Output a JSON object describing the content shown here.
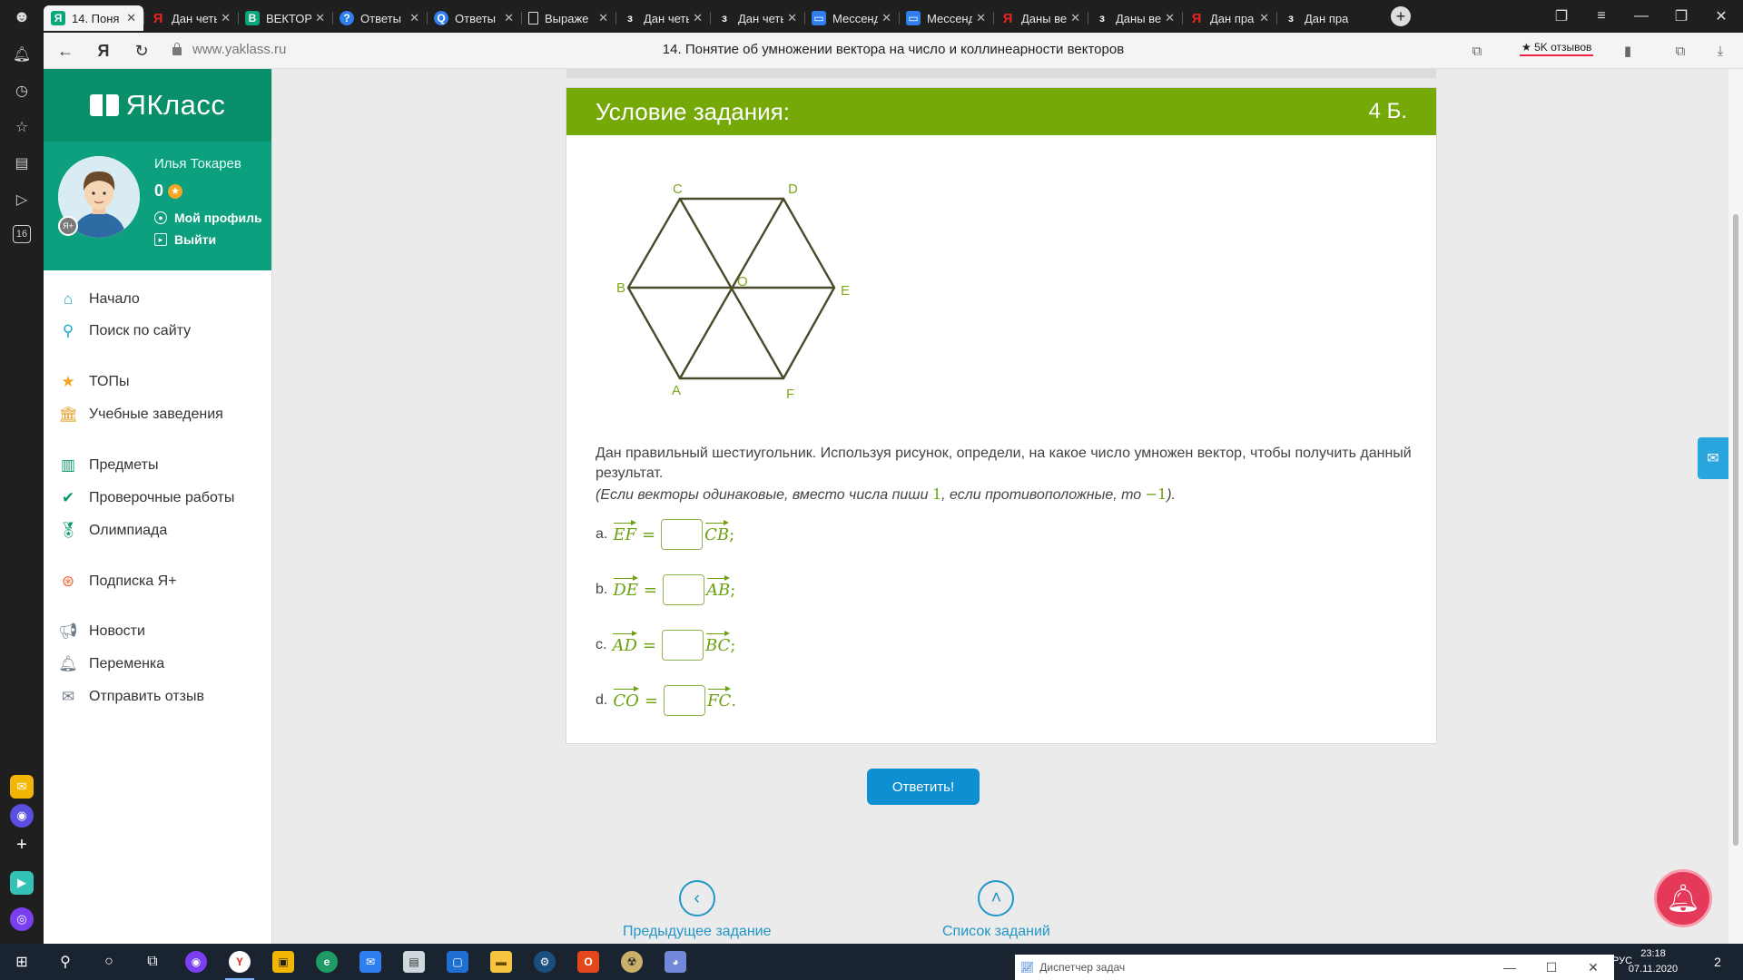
{
  "browser": {
    "tabs": [
      {
        "label": "14. Поня",
        "favicon": "yaklass",
        "active": true
      },
      {
        "label": "Дан четы",
        "favicon": "yandex"
      },
      {
        "label": "ВЕКТОР",
        "favicon": "document-green"
      },
      {
        "label": "Ответы",
        "favicon": "question"
      },
      {
        "label": "Ответы",
        "favicon": "search"
      },
      {
        "label": "Выраже",
        "favicon": "document"
      },
      {
        "label": "Дан четы",
        "favicon": "z"
      },
      {
        "label": "Дан четы",
        "favicon": "z"
      },
      {
        "label": "Мессенд",
        "favicon": "messenger"
      },
      {
        "label": "Мессенд",
        "favicon": "messenger"
      },
      {
        "label": "Даны ве",
        "favicon": "yandex"
      },
      {
        "label": "Даны ве",
        "favicon": "z"
      },
      {
        "label": "Дан пра",
        "favicon": "yandex"
      },
      {
        "label": "Дан пра",
        "favicon": "z"
      }
    ],
    "url": "www.yaklass.ru",
    "page_title": "14. Понятие об умножении вектора на число и коллинеарности векторов",
    "reviews": "★ 5K отзывов"
  },
  "sidebar": {
    "logo": "ЯКласс",
    "user": {
      "name": "Илья Токарев",
      "points": "0",
      "profile_link": "Мой профиль",
      "logout_link": "Выйти",
      "badge": "Я+"
    },
    "nav": [
      {
        "label": "Начало",
        "icon": "home-icon"
      },
      {
        "label": "Поиск по сайту",
        "icon": "search-icon"
      },
      {
        "label": "ТОПы",
        "icon": "star-icon"
      },
      {
        "label": "Учебные заведения",
        "icon": "school-icon"
      },
      {
        "label": "Предметы",
        "icon": "books-icon"
      },
      {
        "label": "Проверочные работы",
        "icon": "check-icon"
      },
      {
        "label": "Олимпиада",
        "icon": "medal-icon"
      },
      {
        "label": "Подписка Я+",
        "icon": "subscription-icon"
      },
      {
        "label": "Новости",
        "icon": "megaphone-icon"
      },
      {
        "label": "Переменка",
        "icon": "bell-icon"
      },
      {
        "label": "Отправить отзыв",
        "icon": "feedback-icon"
      }
    ]
  },
  "task": {
    "header": "Условие задания:",
    "points": "4 Б.",
    "figure_labels": {
      "A": "A",
      "B": "B",
      "C": "C",
      "D": "D",
      "E": "E",
      "F": "F",
      "O": "O"
    },
    "text": "Дан правильный шестиугольник. Используя рисунок, определи, на какое число умножен вектор, чтобы получить данный результат.",
    "hint_before": "(Если векторы одинаковые, вместо числа пиши ",
    "hint_one": "1",
    "hint_middle": ", если противоположные, то ",
    "hint_minus_one": "−1",
    "hint_after": ").",
    "equations": [
      {
        "letter": "a.",
        "left": "EF",
        "right": "CB",
        "end": ";"
      },
      {
        "letter": "b.",
        "left": "DE",
        "right": "AB",
        "end": ";"
      },
      {
        "letter": "c.",
        "left": "AD",
        "right": "BC",
        "end": ";"
      },
      {
        "letter": "d.",
        "left": "CO",
        "right": "FC",
        "end": "."
      }
    ],
    "submit": "Ответить!"
  },
  "footer_nav": {
    "prev": "Предыдущее задание",
    "list": "Список заданий"
  },
  "taskbar": {
    "window_title": "Диспетчер задач",
    "time": "23:18",
    "date": "07.11.2020",
    "lang": "РУС",
    "notifications": "2"
  },
  "colors": {
    "brand_green": "#09906a",
    "task_header": "#75a908",
    "accent_blue": "#0d8fd1",
    "formula_green": "#6aa10e"
  }
}
